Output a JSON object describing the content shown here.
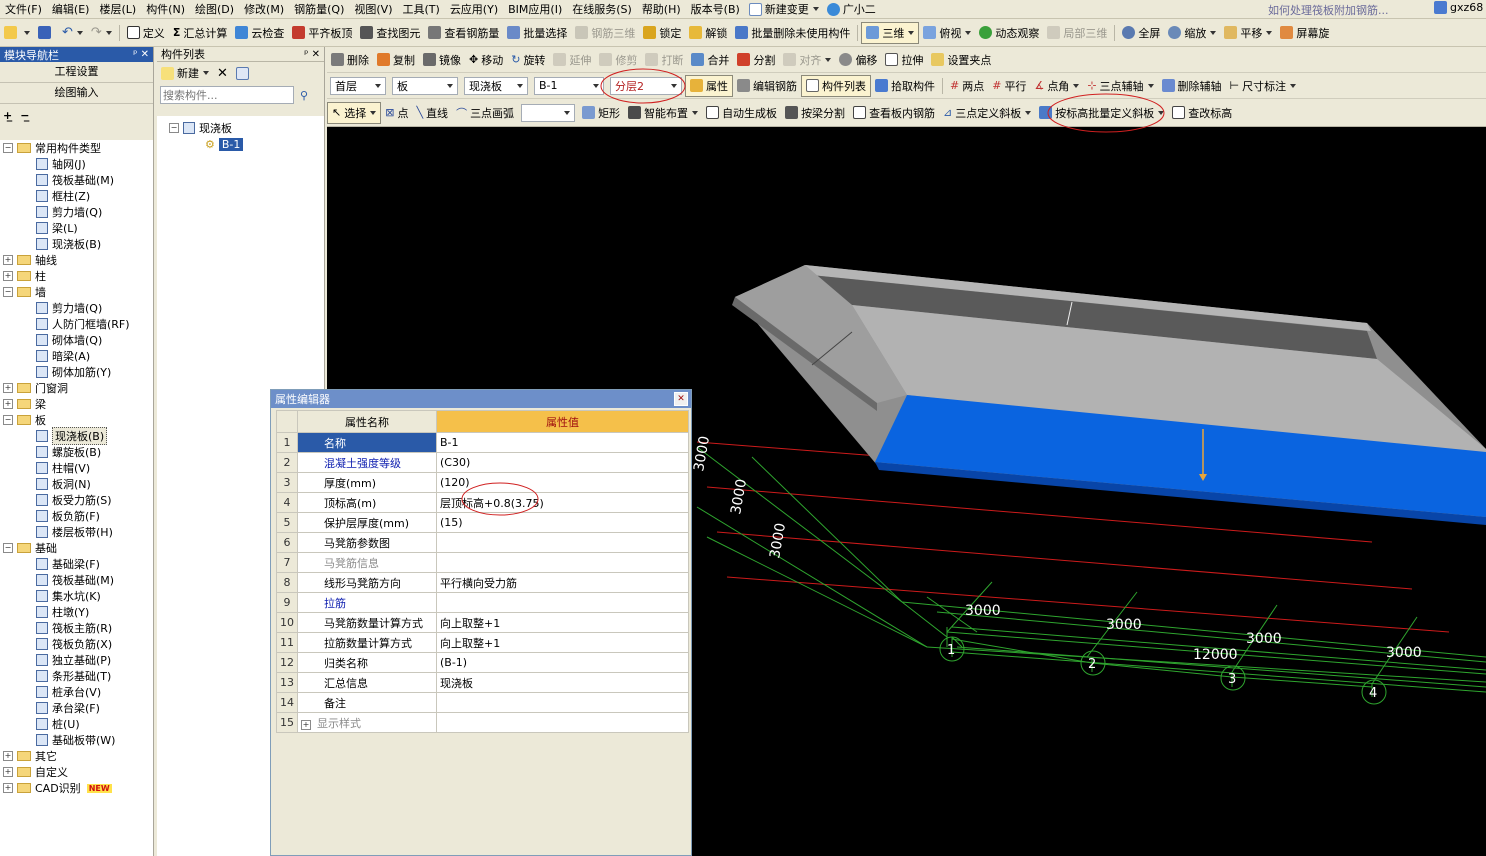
{
  "menu": {
    "items": [
      "文件(F)",
      "编辑(E)",
      "楼层(L)",
      "构件(N)",
      "绘图(D)",
      "修改(M)",
      "钢筋量(Q)",
      "视图(V)",
      "工具(T)",
      "云应用(Y)",
      "BIM应用(I)",
      "在线服务(S)",
      "帮助(H)",
      "版本号(B)"
    ],
    "new_change": "新建变更",
    "user": "广小二",
    "right_title": "如何处理筏板附加钢筋...",
    "account": "gxz68"
  },
  "toolbar1": {
    "define": "定义",
    "sum": "汇总计算",
    "cloud_check": "云检查",
    "flat_top": "平齐板顶",
    "find": "查找图元",
    "view_rebar": "查看钢筋量",
    "batch_select": "批量选择",
    "rebar_3d": "钢筋三维",
    "lock": "锁定",
    "unlock": "解锁",
    "batch_delete": "批量删除未使用构件",
    "three_d": "三维",
    "top_view": "俯视",
    "dynamic": "动态观察",
    "local_3d": "局部三维",
    "fullscreen": "全屏",
    "zoom": "缩放",
    "pan": "平移",
    "screen_rotate": "屏幕旋"
  },
  "toolbar2": {
    "delete": "删除",
    "copy": "复制",
    "mirror": "镜像",
    "move": "移动",
    "rotate": "旋转",
    "extend": "延伸",
    "trim": "修剪",
    "break": "打断",
    "merge": "合并",
    "split": "分割",
    "align": "对齐",
    "offset": "偏移",
    "stretch": "拉伸",
    "grip": "设置夹点"
  },
  "toolbar3": {
    "floor": "首层",
    "category": "板",
    "type": "现浇板",
    "component": "B-1",
    "layer": "分层2",
    "property": "属性",
    "edit_rebar": "编辑钢筋",
    "component_list": "构件列表",
    "pick": "拾取构件",
    "two_points": "两点",
    "parallel": "平行",
    "point_angle": "点角",
    "three_point_aux": "三点辅轴",
    "delete_aux": "删除辅轴",
    "dimension": "尺寸标注"
  },
  "toolbar4": {
    "select": "选择",
    "point": "点",
    "line": "直线",
    "arc": "三点画弧",
    "rect": "矩形",
    "smart_layout": "智能布置",
    "auto_gen": "自动生成板",
    "split_by_beam": "按梁分割",
    "view_inner_rebar": "查看板内钢筋",
    "three_point_slope": "三点定义斜板",
    "batch_slope": "按标高批量定义斜板",
    "check_elev": "查改标高"
  },
  "nav": {
    "title": "模块导航栏",
    "project_settings": "工程设置",
    "drawing_input": "绘图输入",
    "tree": [
      {
        "label": "常用构件类型",
        "level": 0,
        "kind": "folder",
        "exp": "-"
      },
      {
        "label": "轴网(J)",
        "level": 1,
        "kind": "item"
      },
      {
        "label": "筏板基础(M)",
        "level": 1,
        "kind": "item"
      },
      {
        "label": "框柱(Z)",
        "level": 1,
        "kind": "item"
      },
      {
        "label": "剪力墙(Q)",
        "level": 1,
        "kind": "item"
      },
      {
        "label": "梁(L)",
        "level": 1,
        "kind": "item"
      },
      {
        "label": "现浇板(B)",
        "level": 1,
        "kind": "item"
      },
      {
        "label": "轴线",
        "level": 0,
        "kind": "folder",
        "exp": "+"
      },
      {
        "label": "柱",
        "level": 0,
        "kind": "folder",
        "exp": "+"
      },
      {
        "label": "墙",
        "level": 0,
        "kind": "folder",
        "exp": "-"
      },
      {
        "label": "剪力墙(Q)",
        "level": 1,
        "kind": "item"
      },
      {
        "label": "人防门框墙(RF)",
        "level": 1,
        "kind": "item"
      },
      {
        "label": "砌体墙(Q)",
        "level": 1,
        "kind": "item"
      },
      {
        "label": "暗梁(A)",
        "level": 1,
        "kind": "item"
      },
      {
        "label": "砌体加筋(Y)",
        "level": 1,
        "kind": "item"
      },
      {
        "label": "门窗洞",
        "level": 0,
        "kind": "folder",
        "exp": "+"
      },
      {
        "label": "梁",
        "level": 0,
        "kind": "folder",
        "exp": "+"
      },
      {
        "label": "板",
        "level": 0,
        "kind": "folder",
        "exp": "-"
      },
      {
        "label": "现浇板(B)",
        "level": 1,
        "kind": "item",
        "selected": true
      },
      {
        "label": "螺旋板(B)",
        "level": 1,
        "kind": "item"
      },
      {
        "label": "柱帽(V)",
        "level": 1,
        "kind": "item"
      },
      {
        "label": "板洞(N)",
        "level": 1,
        "kind": "item"
      },
      {
        "label": "板受力筋(S)",
        "level": 1,
        "kind": "item"
      },
      {
        "label": "板负筋(F)",
        "level": 1,
        "kind": "item"
      },
      {
        "label": "楼层板带(H)",
        "level": 1,
        "kind": "item"
      },
      {
        "label": "基础",
        "level": 0,
        "kind": "folder",
        "exp": "-"
      },
      {
        "label": "基础梁(F)",
        "level": 1,
        "kind": "item"
      },
      {
        "label": "筏板基础(M)",
        "level": 1,
        "kind": "item"
      },
      {
        "label": "集水坑(K)",
        "level": 1,
        "kind": "item"
      },
      {
        "label": "柱墩(Y)",
        "level": 1,
        "kind": "item"
      },
      {
        "label": "筏板主筋(R)",
        "level": 1,
        "kind": "item"
      },
      {
        "label": "筏板负筋(X)",
        "level": 1,
        "kind": "item"
      },
      {
        "label": "独立基础(P)",
        "level": 1,
        "kind": "item"
      },
      {
        "label": "条形基础(T)",
        "level": 1,
        "kind": "item"
      },
      {
        "label": "桩承台(V)",
        "level": 1,
        "kind": "item"
      },
      {
        "label": "承台梁(F)",
        "level": 1,
        "kind": "item"
      },
      {
        "label": "桩(U)",
        "level": 1,
        "kind": "item"
      },
      {
        "label": "基础板带(W)",
        "level": 1,
        "kind": "item"
      },
      {
        "label": "其它",
        "level": 0,
        "kind": "folder",
        "exp": "+"
      },
      {
        "label": "自定义",
        "level": 0,
        "kind": "folder",
        "exp": "+"
      },
      {
        "label": "CAD识别",
        "level": 0,
        "kind": "folder",
        "exp": "+",
        "badge": "NEW"
      }
    ]
  },
  "component_list": {
    "title": "构件列表",
    "new_label": "新建",
    "search_placeholder": "搜索构件...",
    "root": "现浇板",
    "child": "B-1"
  },
  "property_editor": {
    "title": "属性编辑器",
    "col_name": "属性名称",
    "col_value": "属性值",
    "rows": [
      {
        "n": "1",
        "name": "名称",
        "value": "B-1",
        "style": "blue"
      },
      {
        "n": "2",
        "name": "混凝土强度等级",
        "value": "(C30)",
        "style": "blue"
      },
      {
        "n": "3",
        "name": "厚度(mm)",
        "value": "(120)",
        "style": "black"
      },
      {
        "n": "4",
        "name": "顶标高(m)",
        "value": "层顶标高+0.8(3.75)",
        "style": "black"
      },
      {
        "n": "5",
        "name": "保护层厚度(mm)",
        "value": "(15)",
        "style": "black"
      },
      {
        "n": "6",
        "name": "马凳筋参数图",
        "value": "",
        "style": "black"
      },
      {
        "n": "7",
        "name": "马凳筋信息",
        "value": "",
        "style": "gray"
      },
      {
        "n": "8",
        "name": "线形马凳筋方向",
        "value": "平行横向受力筋",
        "style": "black"
      },
      {
        "n": "9",
        "name": "拉筋",
        "value": "",
        "style": "blue"
      },
      {
        "n": "10",
        "name": "马凳筋数量计算方式",
        "value": "向上取整+1",
        "style": "black"
      },
      {
        "n": "11",
        "name": "拉筋数量计算方式",
        "value": "向上取整+1",
        "style": "black"
      },
      {
        "n": "12",
        "name": "归类名称",
        "value": "(B-1)",
        "style": "black"
      },
      {
        "n": "13",
        "name": "汇总信息",
        "value": "现浇板",
        "style": "black"
      },
      {
        "n": "14",
        "name": "备注",
        "value": "",
        "style": "black"
      },
      {
        "n": "15",
        "name": "显示样式",
        "value": "",
        "style": "gray"
      }
    ]
  },
  "viewport": {
    "dims_left": [
      "3000",
      "3000",
      "3000"
    ],
    "dims_bottom": [
      "3000",
      "3000",
      "3000",
      "3000"
    ],
    "total": "12000",
    "axes": [
      "1",
      "2",
      "3",
      "4"
    ]
  },
  "colors": {
    "accent": "#2a5aa8",
    "slab_blue": "#0a64e0",
    "grid_red": "#cc1b1b",
    "grid_green": "#2fa52f"
  }
}
